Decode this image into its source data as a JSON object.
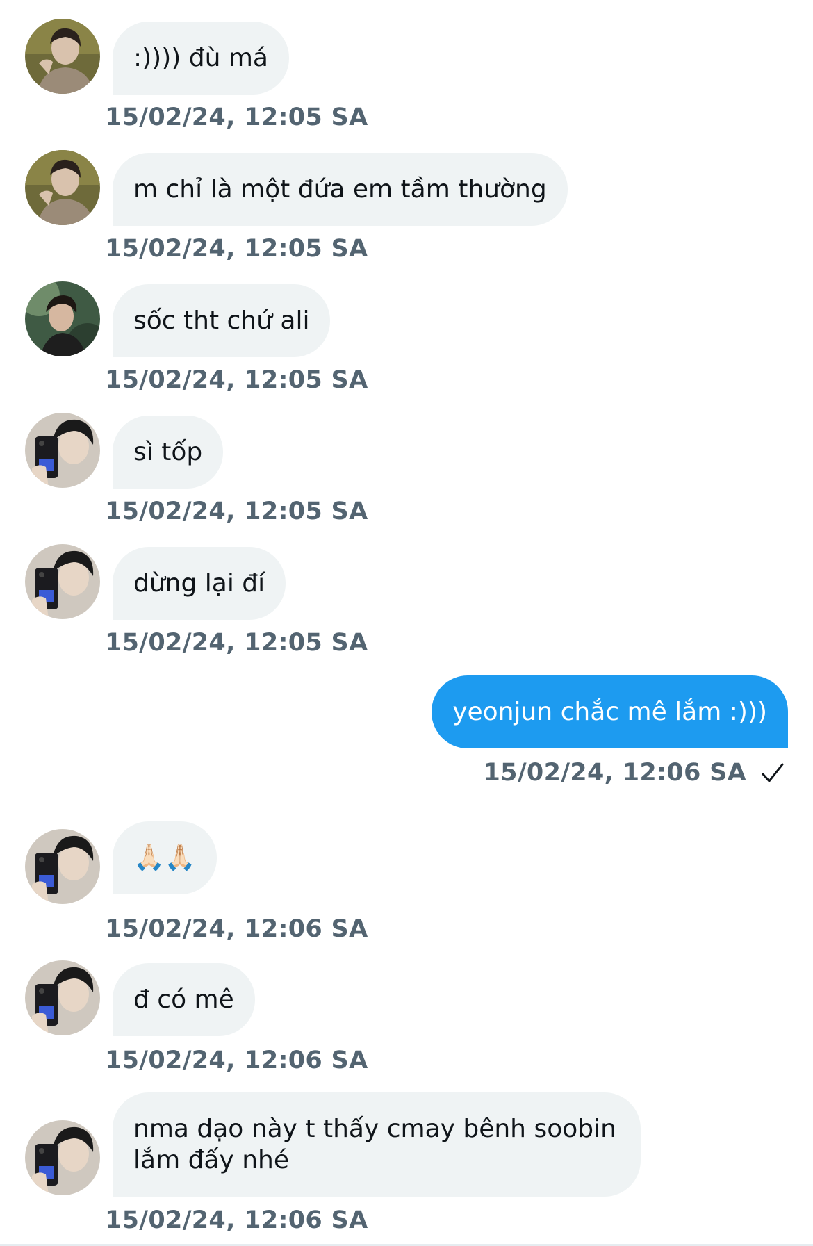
{
  "conversation": {
    "messages": [
      {
        "sender": "other",
        "avatar": "avatar-a",
        "text": ":)))) đù má",
        "time": "15/02/24, 12:05 SA"
      },
      {
        "sender": "other",
        "avatar": "avatar-a",
        "text": "m chỉ là một đứa em tầm thường",
        "time": "15/02/24, 12:05 SA"
      },
      {
        "sender": "other",
        "avatar": "avatar-b",
        "text": "sốc tht chứ ali",
        "time": "15/02/24, 12:05 SA"
      },
      {
        "sender": "other",
        "avatar": "avatar-c",
        "text": "sì tốp",
        "time": "15/02/24, 12:05 SA"
      },
      {
        "sender": "other",
        "avatar": "avatar-c",
        "text": "dừng lại đí",
        "time": "15/02/24, 12:05 SA"
      },
      {
        "sender": "me",
        "text": "yeonjun chắc mê lắm :)))",
        "time": "15/02/24, 12:06 SA",
        "status_icon": "checkmark-icon"
      },
      {
        "sender": "other",
        "avatar": "avatar-c",
        "text": "🙏🏻🙏🏻",
        "time": "15/02/24, 12:06 SA"
      },
      {
        "sender": "other",
        "avatar": "avatar-c",
        "text": "đ có mê",
        "time": "15/02/24, 12:06 SA"
      },
      {
        "sender": "other",
        "avatar": "avatar-c",
        "text": "nma dạo này t thấy cmay bênh soobin lắm đấy nhé",
        "time": "15/02/24, 12:06 SA"
      }
    ]
  },
  "colors": {
    "received_bubble": "#eff3f4",
    "sent_bubble": "#1d9bf0",
    "timestamp": "#536471",
    "text": "#0f1419"
  }
}
